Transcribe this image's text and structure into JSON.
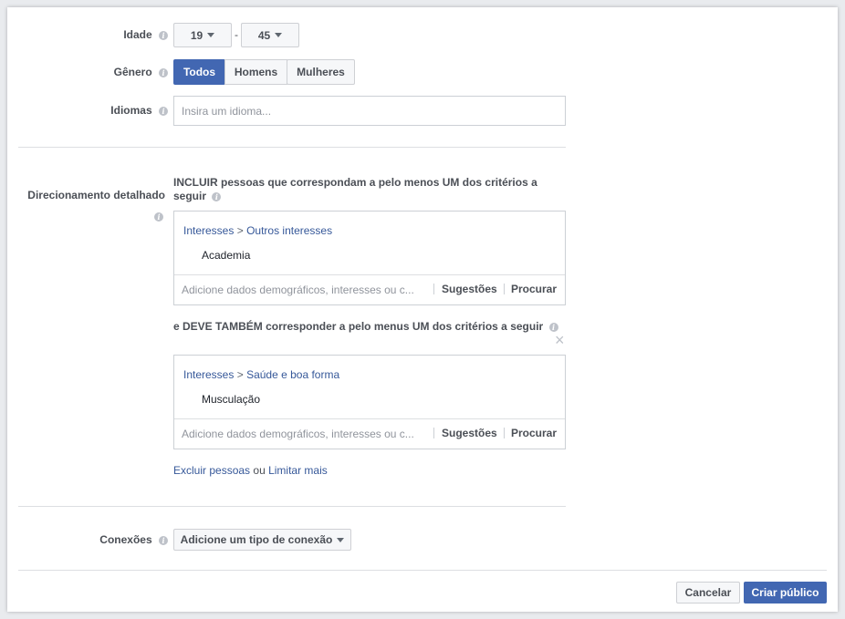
{
  "age": {
    "label": "Idade",
    "min": "19",
    "separator": "-",
    "max": "45"
  },
  "gender": {
    "label": "Gênero",
    "options": [
      "Todos",
      "Homens",
      "Mulheres"
    ],
    "selected": "Todos"
  },
  "languages": {
    "label": "Idiomas",
    "placeholder": "Insira um idioma..."
  },
  "detailed": {
    "label": "Direcionamento detalhado",
    "include_text_1": "INCLUIR pessoas que correspondam a pelo menos UM dos critérios a",
    "include_text_2": "seguir",
    "box1": {
      "crumb_root": "Interesses",
      "crumb_sep": ">",
      "crumb_leaf": "Outros interesses",
      "item": "Academia",
      "placeholder": "Adicione dados demográficos, interesses ou c...",
      "suggestions": "Sugestões",
      "browse": "Procurar"
    },
    "also_text": "e DEVE TAMBÉM corresponder a pelo menus UM dos critérios a seguir",
    "close_glyph": "×",
    "box2": {
      "crumb_root": "Interesses",
      "crumb_sep": ">",
      "crumb_leaf": "Saúde e boa forma",
      "item": "Musculação",
      "placeholder": "Adicione dados demográficos, interesses ou c...",
      "suggestions": "Sugestões",
      "browse": "Procurar"
    },
    "exclude_link": "Excluir pessoas",
    "or_text": "ou",
    "narrow_link": "Limitar mais"
  },
  "connections": {
    "label": "Conexões",
    "button": "Adicione um tipo de conexão"
  },
  "footer": {
    "cancel": "Cancelar",
    "create": "Criar público"
  },
  "info_glyph": "i",
  "colors": {
    "accent": "#4267b2",
    "link": "#365899",
    "border": "#ccd0d5"
  }
}
